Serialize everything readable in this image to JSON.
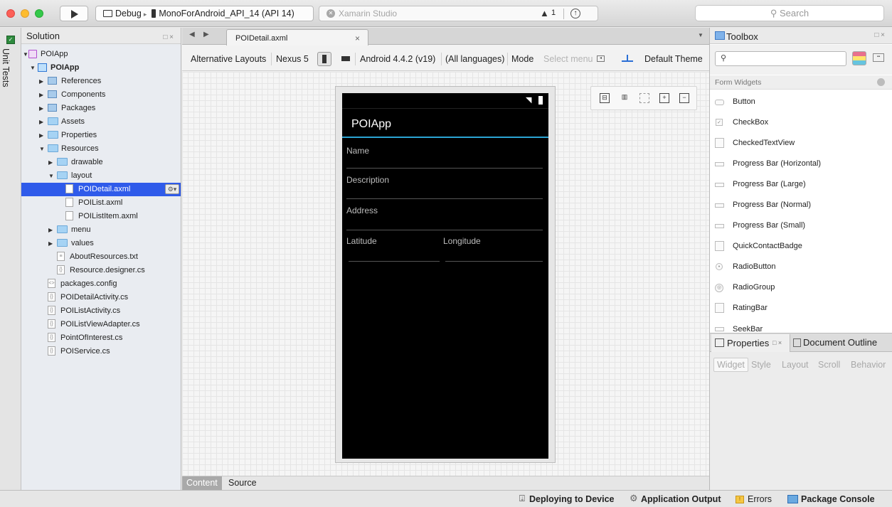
{
  "titlebar": {
    "config_debug": "Debug",
    "config_target": "MonoForAndroid_API_14 (API 14)",
    "status_app": "Xamarin Studio",
    "warning_count": "1",
    "search_placeholder": "Search"
  },
  "unit_tests": {
    "label": "Unit Tests"
  },
  "solution": {
    "title": "Solution",
    "dock": "□ ×",
    "gear": "⚙▾",
    "items": [
      {
        "label": "POIApp"
      },
      {
        "label": "POIApp"
      },
      {
        "label": "References"
      },
      {
        "label": "Components"
      },
      {
        "label": "Packages"
      },
      {
        "label": "Assets"
      },
      {
        "label": "Properties"
      },
      {
        "label": "Resources"
      },
      {
        "label": "drawable"
      },
      {
        "label": "layout"
      },
      {
        "label": "POIDetail.axml"
      },
      {
        "label": "POIList.axml"
      },
      {
        "label": "POIListItem.axml"
      },
      {
        "label": "menu"
      },
      {
        "label": "values"
      },
      {
        "label": "AboutResources.txt"
      },
      {
        "label": "Resource.designer.cs"
      },
      {
        "label": "packages.config"
      },
      {
        "label": "POIDetailActivity.cs"
      },
      {
        "label": "POIListActivity.cs"
      },
      {
        "label": "POIListViewAdapter.cs"
      },
      {
        "label": "PointOfInterest.cs"
      },
      {
        "label": "POIService.cs"
      }
    ]
  },
  "editor": {
    "tab_label": "POIDetail.axml",
    "toolbar": {
      "alt_layouts": "Alternative Layouts",
      "device": "Nexus 5",
      "android_version": "Android 4.4.2 (v19)",
      "language": "(All languages)",
      "mode": "Mode",
      "select_menu": "Select menu",
      "theme": "Default Theme"
    },
    "phone": {
      "app_title": "POIApp",
      "fields": {
        "name": "Name",
        "description": "Description",
        "address": "Address",
        "latitude": "Latitude",
        "longitude": "Longitude"
      }
    },
    "bottom_tabs": {
      "content": "Content",
      "source": "Source"
    }
  },
  "toolbox": {
    "title": "Toolbox",
    "dock": "□ ×",
    "category": "Form Widgets",
    "items": [
      {
        "label": "Button"
      },
      {
        "label": "CheckBox"
      },
      {
        "label": "CheckedTextView"
      },
      {
        "label": "Progress Bar (Horizontal)"
      },
      {
        "label": "Progress Bar (Large)"
      },
      {
        "label": "Progress Bar (Normal)"
      },
      {
        "label": "Progress Bar (Small)"
      },
      {
        "label": "QuickContactBadge"
      },
      {
        "label": "RadioButton"
      },
      {
        "label": "RadioGroup"
      },
      {
        "label": "RatingBar"
      },
      {
        "label": "SeekBar"
      }
    ]
  },
  "properties": {
    "title": "Properties",
    "dock": "□ ×",
    "outline": "Document Outline",
    "tabs": [
      "Widget",
      "Style",
      "Layout",
      "Scroll",
      "Behavior"
    ]
  },
  "statusbar": {
    "deploying": "Deploying to Device",
    "output": "Application Output",
    "errors": "Errors",
    "console": "Package Console"
  }
}
